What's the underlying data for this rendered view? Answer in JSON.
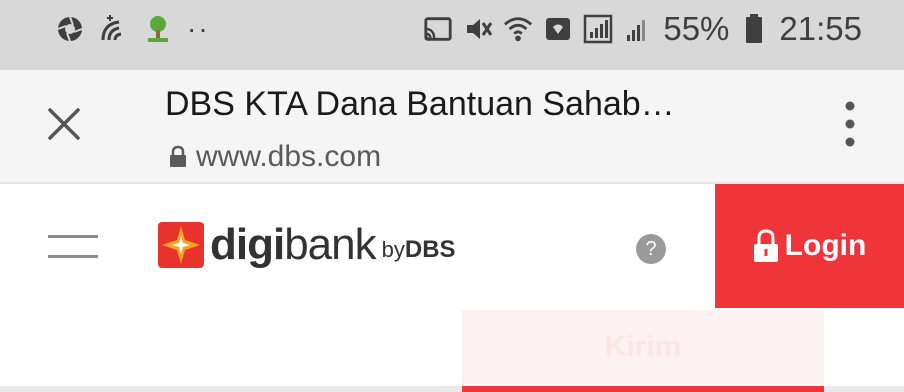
{
  "status_bar": {
    "battery_percent": "55%",
    "time": "21:55",
    "dots": "··",
    "left_icons": [
      "aperture-icon",
      "wifi-calling-icon",
      "tree-icon"
    ],
    "right_icons": [
      "cast-icon",
      "mute-icon",
      "wifi-icon",
      "shield-icon",
      "signal-box-icon",
      "signal-icon",
      "battery-icon"
    ]
  },
  "browser": {
    "page_title": "DBS KTA Dana Bantuan Sahab…",
    "url": "www.dbs.com"
  },
  "site_header": {
    "logo_digi": "digi",
    "logo_bank": "bank",
    "logo_by": "by",
    "logo_dbs": "DBS",
    "help_label": "?",
    "login_label": "Login"
  },
  "content": {
    "kirim_label": "Kirim"
  },
  "colors": {
    "brand_red": "#f0353a",
    "status_bar_bg": "#d8d8d8"
  }
}
